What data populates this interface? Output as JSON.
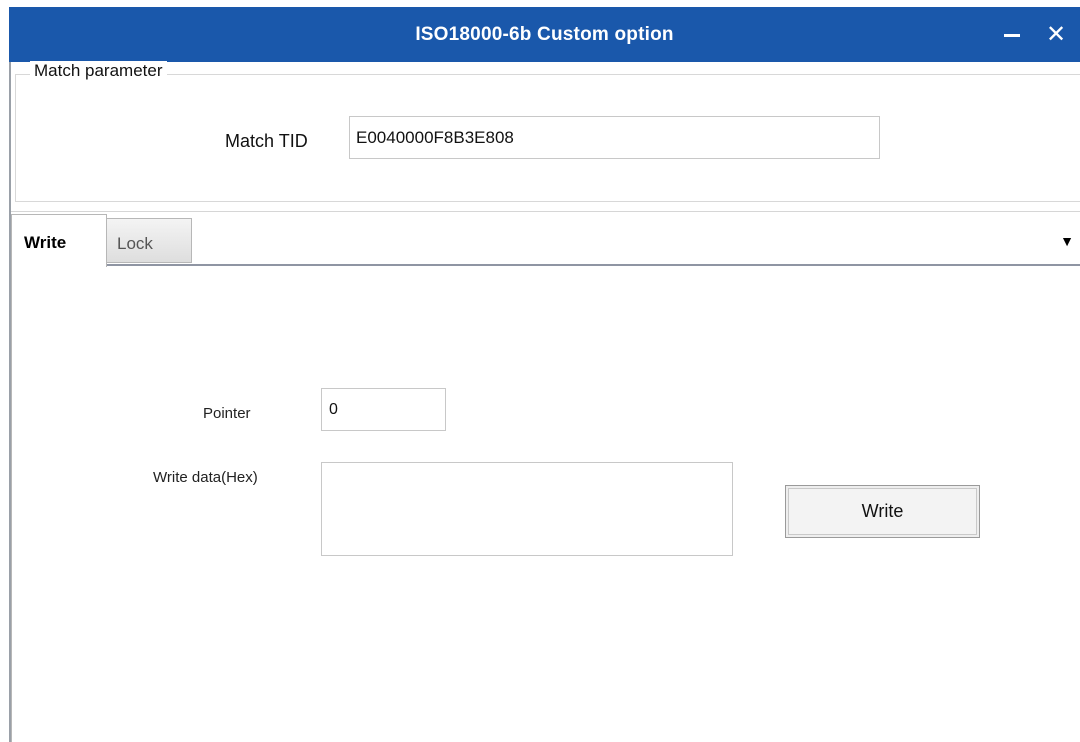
{
  "window": {
    "title": "ISO18000-6b Custom option",
    "minimize_glyph": "—",
    "close_glyph": "✕",
    "titlebar_color": "#1a58ab"
  },
  "match_group": {
    "legend": "Match parameter",
    "tid_label": "Match TID",
    "tid_value": "E0040000F8B3E808"
  },
  "tabs": [
    {
      "label": "Write",
      "active": true
    },
    {
      "label": "Lock",
      "active": false
    }
  ],
  "tab_dropdown_icon": "▼",
  "write_tab": {
    "pointer_label": "Pointer",
    "pointer_value": "0",
    "write_data_label": "Write data(Hex)",
    "write_data_value": "",
    "write_button_label": "Write"
  }
}
